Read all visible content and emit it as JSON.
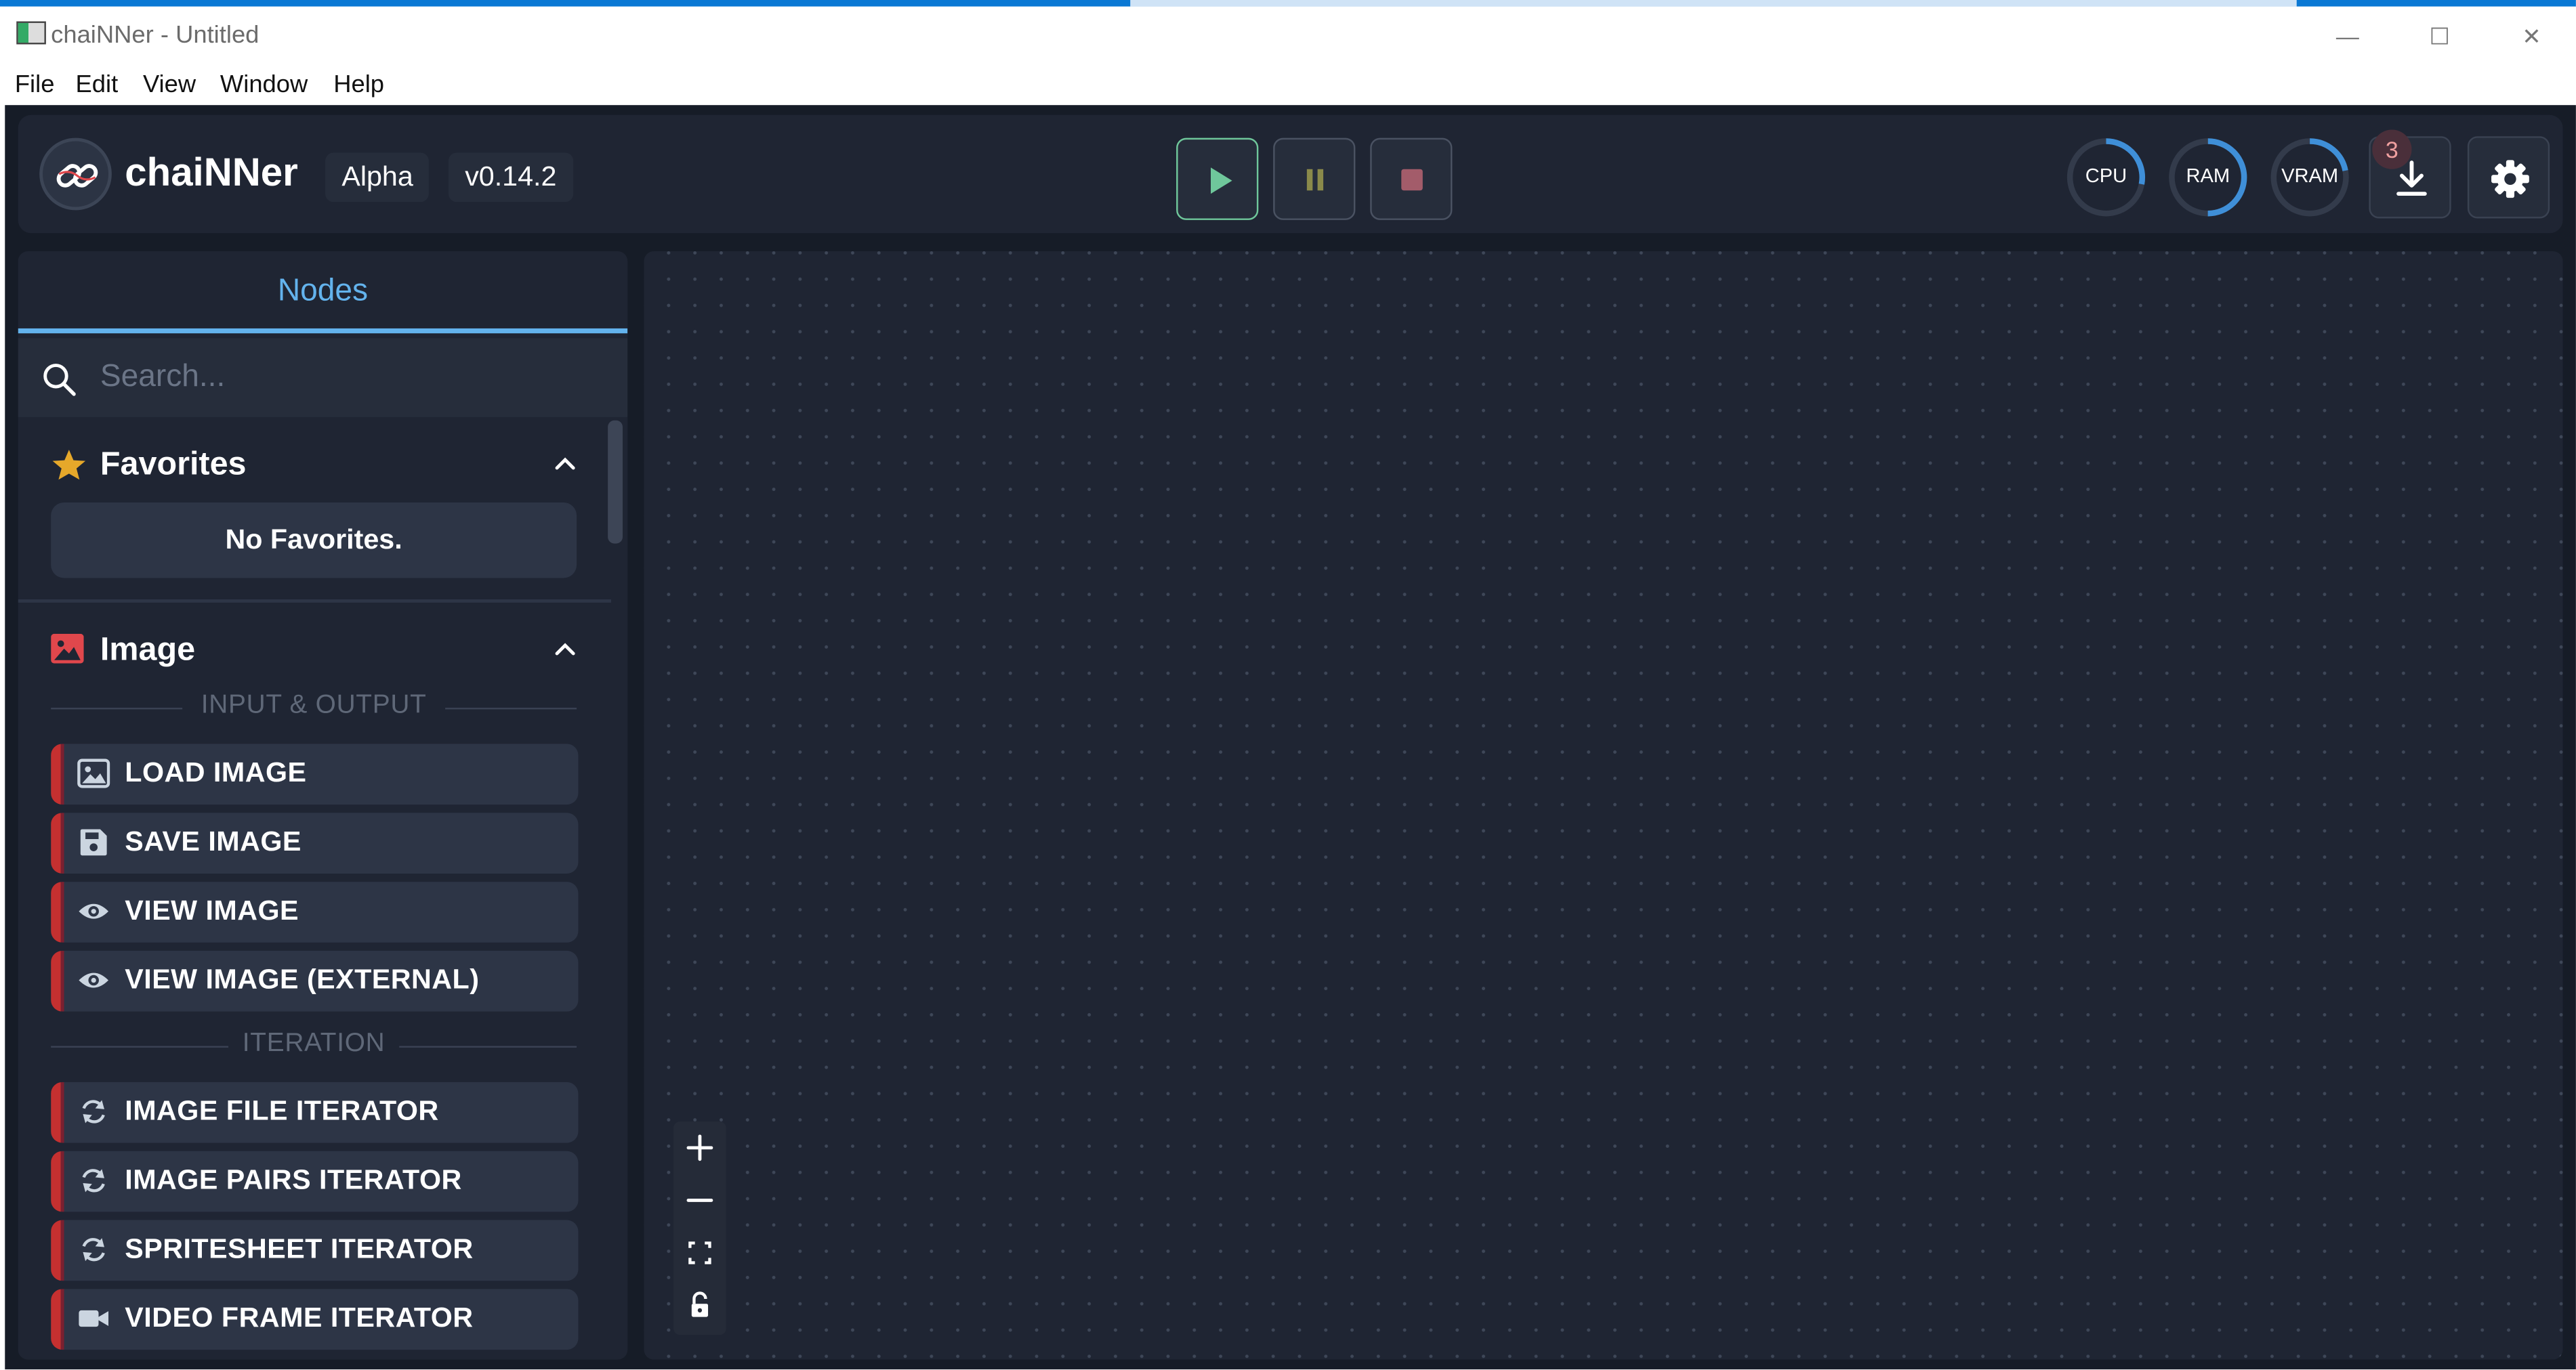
{
  "window": {
    "title": "chaiNNer - Untitled",
    "controls": {
      "minimize": "—",
      "maximize": "☐",
      "close": "✕"
    }
  },
  "menu": [
    "File",
    "Edit",
    "View",
    "Window",
    "Help"
  ],
  "header": {
    "brand": "chaiNNer",
    "channel": "Alpha",
    "version": "v0.14.2",
    "gauges": [
      {
        "label": "CPU",
        "percent": 28,
        "color": "#3f8fd8"
      },
      {
        "label": "RAM",
        "percent": 50,
        "color": "#3f8fd8"
      },
      {
        "label": "VRAM",
        "percent": 22,
        "color": "#3f8fd8"
      }
    ],
    "notification_count": "3",
    "colors": {
      "run": "#6fc79b",
      "pause": "#8a8a4a",
      "stop": "#a35c6a"
    }
  },
  "sidebar": {
    "tab": "Nodes",
    "search_placeholder": "Search...",
    "favorites": {
      "title": "Favorites",
      "empty_text": "No Favorites."
    },
    "image": {
      "title": "Image",
      "groups": [
        {
          "label": "INPUT & OUTPUT",
          "nodes": [
            "LOAD IMAGE",
            "SAVE IMAGE",
            "VIEW IMAGE",
            "VIEW IMAGE (EXTERNAL)"
          ]
        },
        {
          "label": "ITERATION",
          "nodes": [
            "IMAGE FILE ITERATOR",
            "IMAGE PAIRS ITERATOR",
            "SPRITESHEET ITERATOR",
            "VIDEO FRAME ITERATOR"
          ]
        }
      ]
    },
    "accent_color": "#c53030"
  },
  "canvas": {
    "zoom_controls": [
      "zoom-in",
      "zoom-out",
      "fit-view",
      "lock"
    ]
  }
}
